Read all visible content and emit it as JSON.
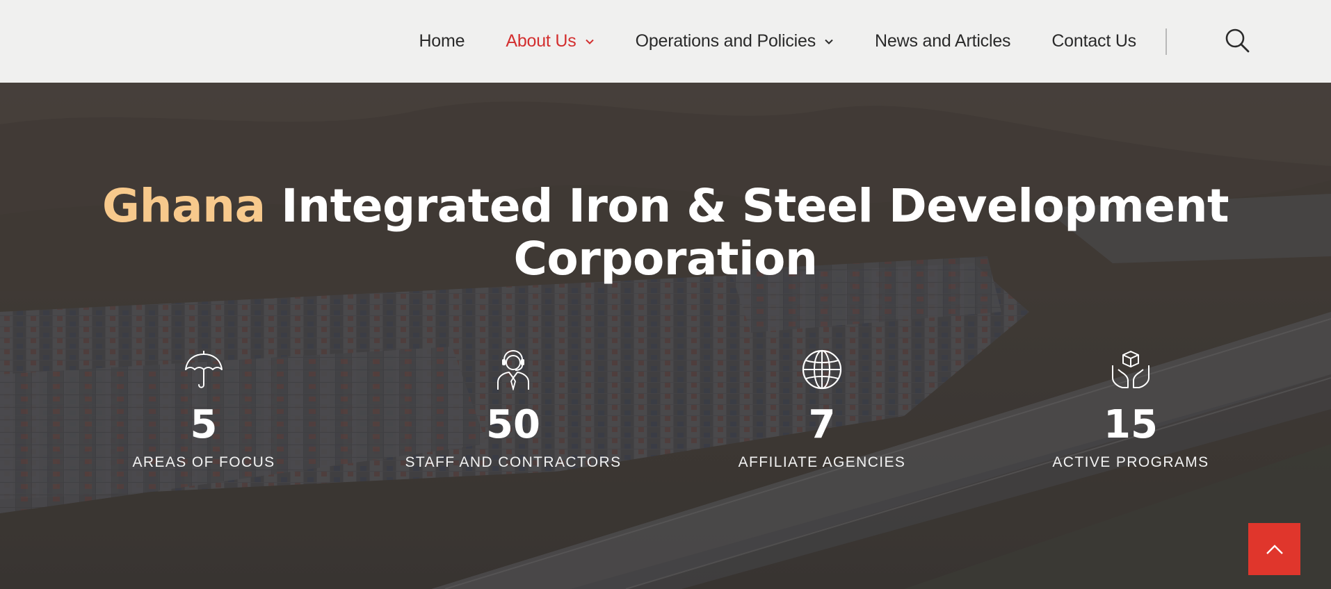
{
  "nav": {
    "items": [
      {
        "label": "Home",
        "active": false,
        "has_dropdown": false
      },
      {
        "label": "About Us",
        "active": true,
        "has_dropdown": true
      },
      {
        "label": "Operations and Policies",
        "active": false,
        "has_dropdown": true
      },
      {
        "label": "News and Articles",
        "active": false,
        "has_dropdown": false
      },
      {
        "label": "Contact Us",
        "active": false,
        "has_dropdown": false
      }
    ],
    "search_icon": "search-icon"
  },
  "hero": {
    "title_accent": "Ghana",
    "title_rest_line1": "Integrated Iron & Steel Development",
    "title_line2": "Corporation",
    "accent_color": "#f7c98c"
  },
  "stats": [
    {
      "icon": "umbrella-icon",
      "value": "5",
      "label": "AREAS OF FOCUS"
    },
    {
      "icon": "support-agent-icon",
      "value": "50",
      "label": "STAFF AND CONTRACTORS"
    },
    {
      "icon": "globe-icon",
      "value": "7",
      "label": "AFFILIATE AGENCIES"
    },
    {
      "icon": "hands-box-icon",
      "value": "15",
      "label": "ACTIVE PROGRAMS"
    }
  ],
  "scroll_top": {
    "icon": "chevron-up-icon",
    "color": "#e0362c"
  },
  "colors": {
    "active_nav": "#d32f2f",
    "header_bg": "#f0f0ef"
  }
}
